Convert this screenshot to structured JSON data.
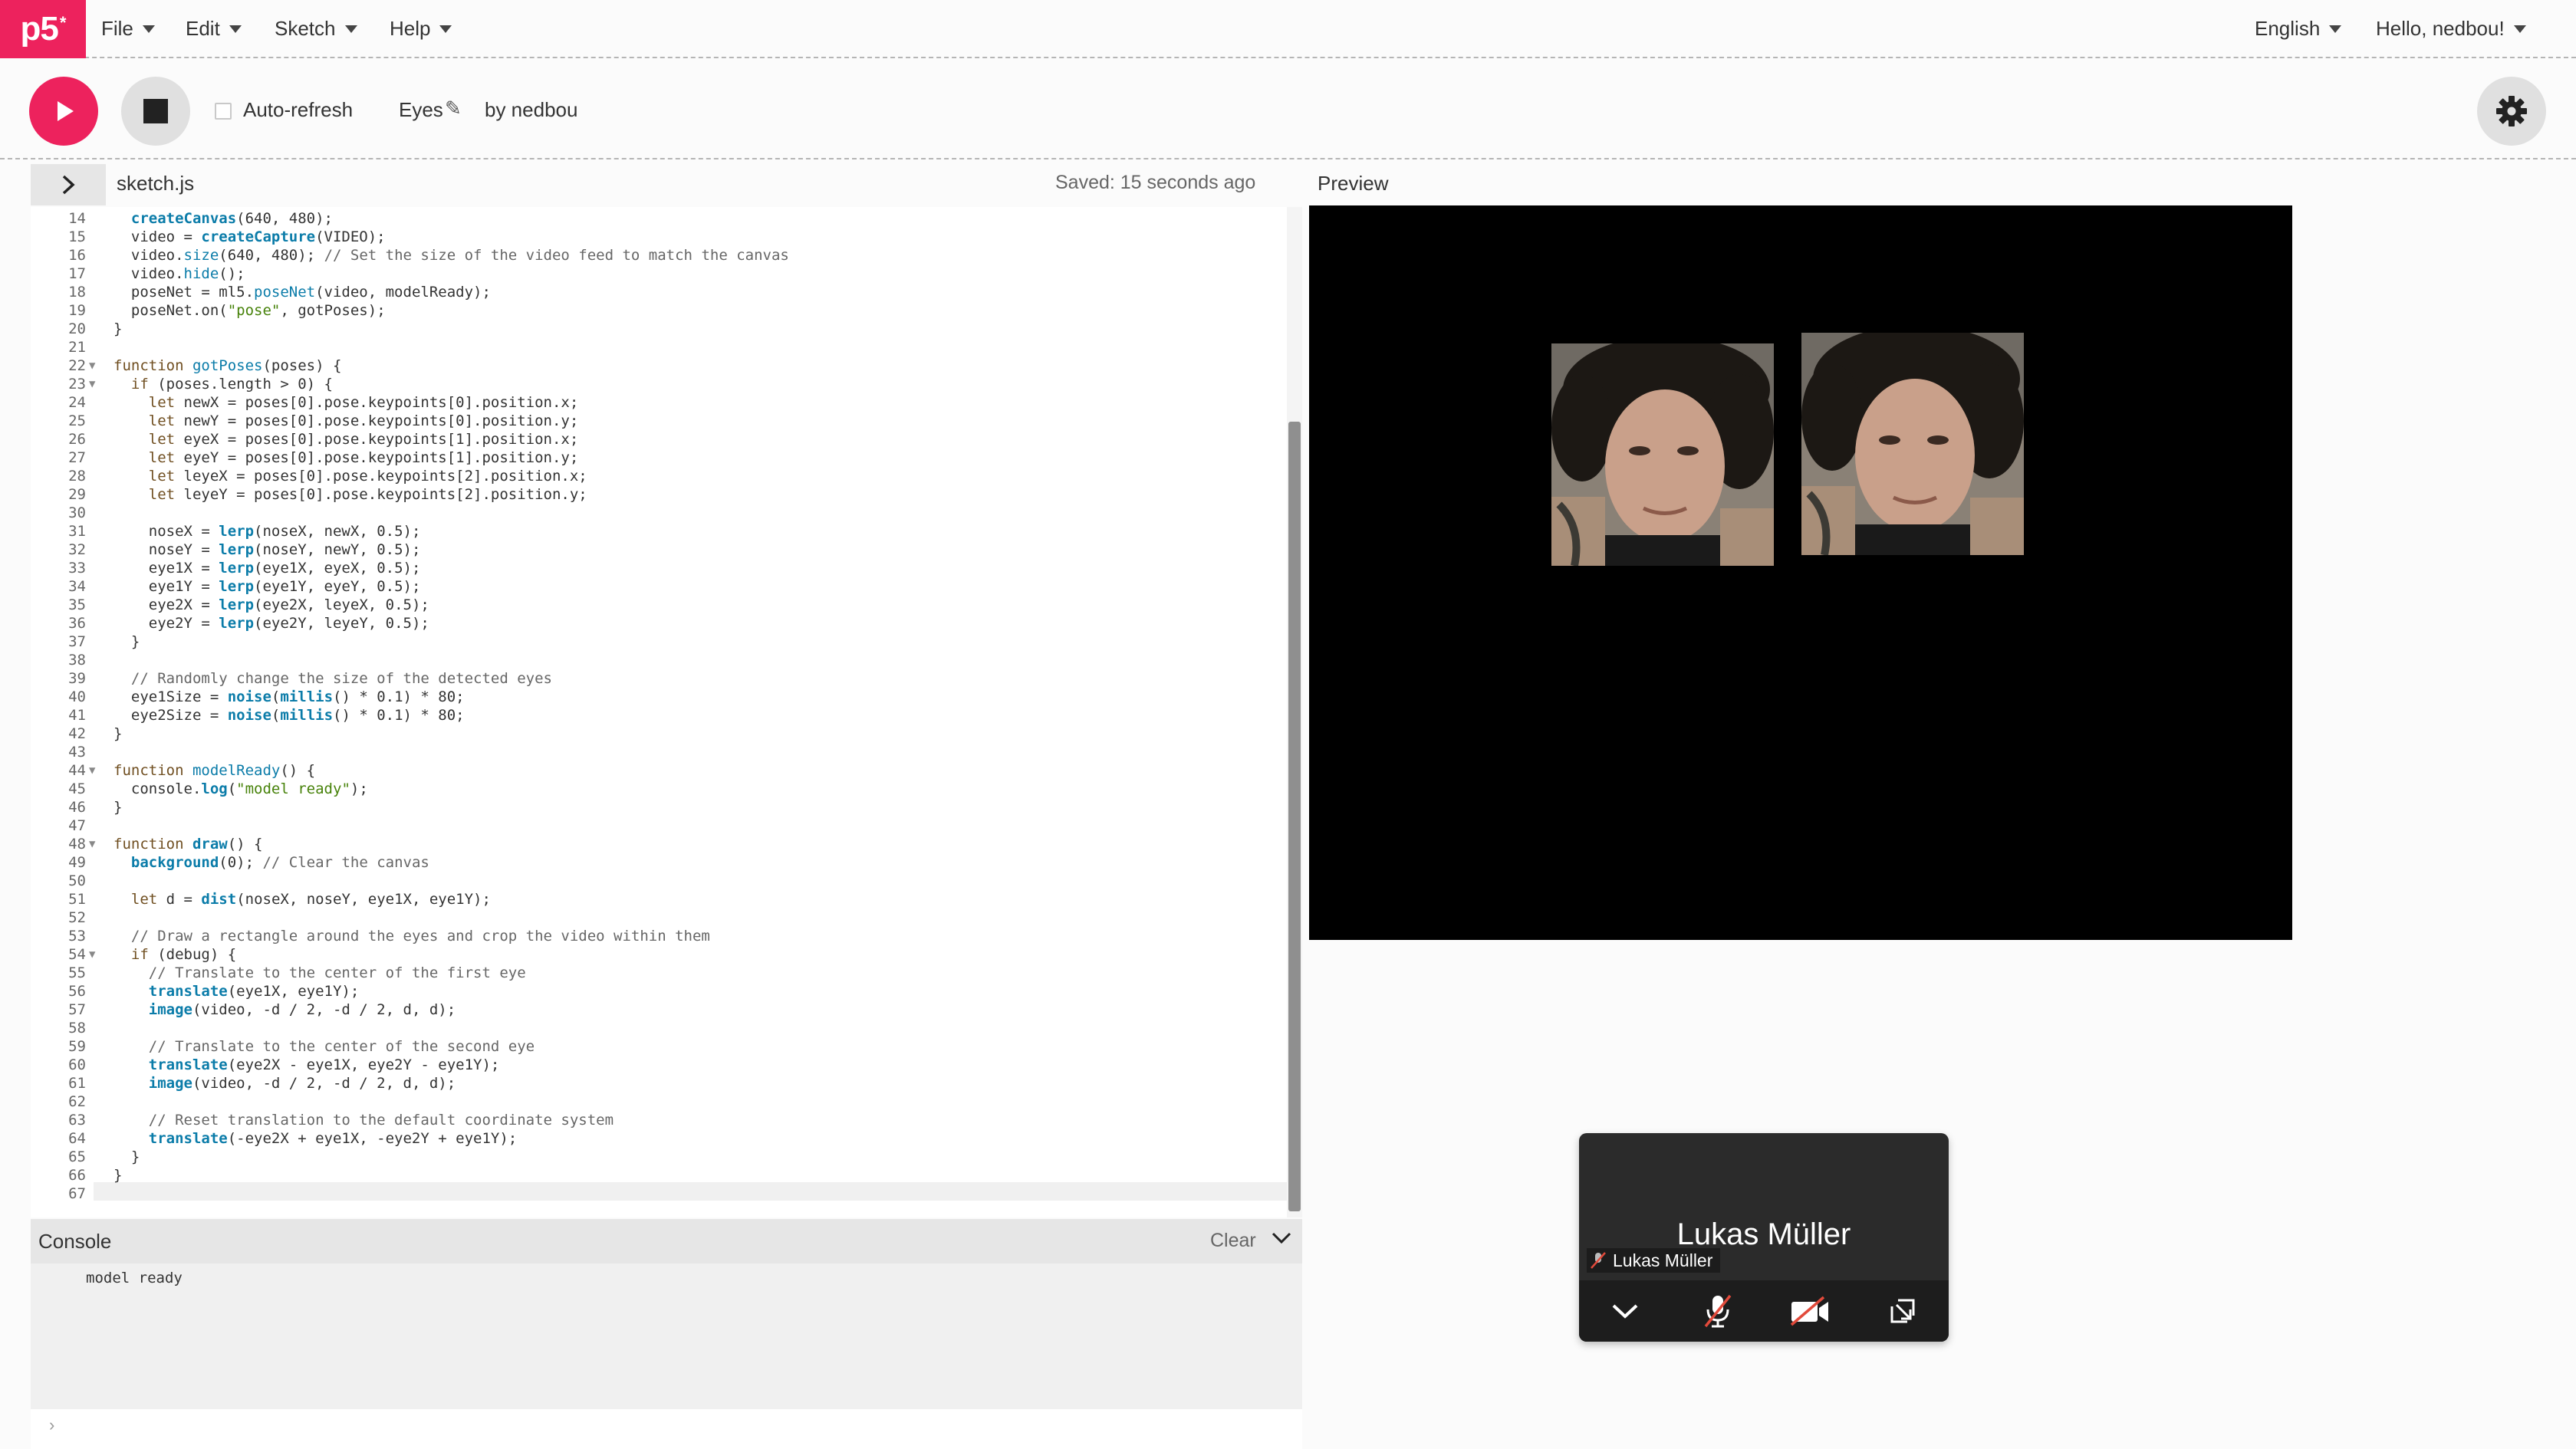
{
  "nav": {
    "logo": "p5",
    "logo_sup": "*",
    "menus": [
      "File",
      "Edit",
      "Sketch",
      "Help"
    ],
    "language": "English",
    "user": "Hello, nedbou!"
  },
  "toolbar": {
    "auto_refresh_label": "Auto-refresh",
    "auto_refresh_checked": false,
    "project_name": "Eyes",
    "author": "by nedbou"
  },
  "editor": {
    "filename": "sketch.js",
    "saved_status": "Saved: 15 seconds ago",
    "preview_label": "Preview",
    "first_line_number": 14,
    "code_lines": [
      "  createCanvas(640, 480);",
      "  video = createCapture(VIDEO);",
      "  video.size(640, 480); // Set the size of the video feed to match the canvas",
      "  video.hide();",
      "  poseNet = ml5.poseNet(video, modelReady);",
      "  poseNet.on(\"pose\", gotPoses);",
      "}",
      "",
      "function gotPoses(poses) {",
      "  if (poses.length > 0) {",
      "    let newX = poses[0].pose.keypoints[0].position.x;",
      "    let newY = poses[0].pose.keypoints[0].position.y;",
      "    let eyeX = poses[0].pose.keypoints[1].position.x;",
      "    let eyeY = poses[0].pose.keypoints[1].position.y;",
      "    let leyeX = poses[0].pose.keypoints[2].position.x;",
      "    let leyeY = poses[0].pose.keypoints[2].position.y;",
      "",
      "    noseX = lerp(noseX, newX, 0.5);",
      "    noseY = lerp(noseY, newY, 0.5);",
      "    eye1X = lerp(eye1X, eyeX, 0.5);",
      "    eye1Y = lerp(eye1Y, eyeY, 0.5);",
      "    eye2X = lerp(eye2X, leyeX, 0.5);",
      "    eye2Y = lerp(eye2Y, leyeY, 0.5);",
      "  }",
      "",
      "  // Randomly change the size of the detected eyes",
      "  eye1Size = noise(millis() * 0.1) * 80;",
      "  eye2Size = noise(millis() * 0.1) * 80;",
      "}",
      "",
      "function modelReady() {",
      "  console.log(\"model ready\");",
      "}",
      "",
      "function draw() {",
      "  background(0); // Clear the canvas",
      "",
      "  let d = dist(noseX, noseY, eye1X, eye1Y);",
      "",
      "  // Draw a rectangle around the eyes and crop the video within them",
      "  if (debug) {",
      "    // Translate to the center of the first eye",
      "    translate(eye1X, eye1Y);",
      "    image(video, -d / 2, -d / 2, d, d);",
      "",
      "    // Translate to the center of the second eye",
      "    translate(eye2X - eye1X, eye2Y - eye1Y);",
      "    image(video, -d / 2, -d / 2, d, d);",
      "",
      "    // Reset translation to the default coordinate system",
      "    translate(-eye2X + eye1X, -eye2Y + eye1Y);",
      "  }",
      "}",
      ""
    ],
    "fold_lines": [
      22,
      23,
      44,
      48,
      54
    ]
  },
  "console": {
    "label": "Console",
    "clear_label": "Clear",
    "output": "model ready",
    "prompt": "›"
  },
  "call": {
    "participant_name": "Lukas Müller",
    "participant_label": "Lukas Müller"
  },
  "colors": {
    "accent": "#ed225d",
    "canvas_bg": "#000000",
    "keyword": "#704f21",
    "function": "#0b7ca9",
    "string": "#47820a"
  }
}
